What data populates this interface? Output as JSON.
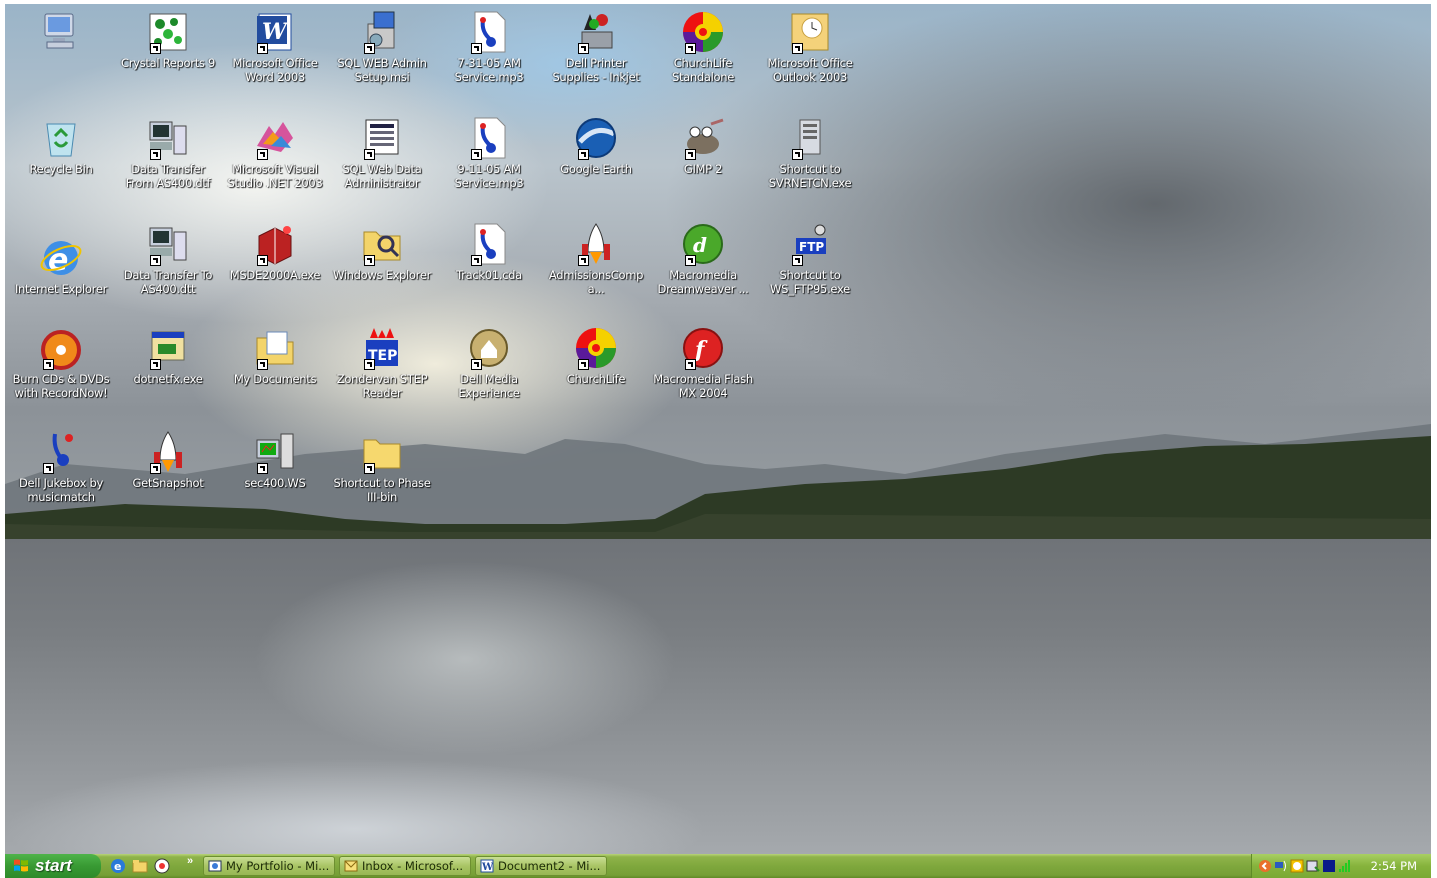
{
  "desktop": {
    "icons": [
      {
        "label": "",
        "icon": "my-computer-icon"
      },
      {
        "label": "Crystal Reports 9",
        "icon": "crystal-reports-icon"
      },
      {
        "label": "Microsoft Office Word 2003",
        "icon": "word-icon"
      },
      {
        "label": "SQL WEB Admin Setup.msi",
        "icon": "installer-icon"
      },
      {
        "label": "7-31-05 AM Service.mp3",
        "icon": "mp3-icon"
      },
      {
        "label": "Dell Printer Supplies - Inkjet",
        "icon": "printer-supplies-icon"
      },
      {
        "label": "ChurchLife Standalone",
        "icon": "churchlife-icon"
      },
      {
        "label": "Microsoft Office Outlook 2003",
        "icon": "outlook-icon"
      },
      {
        "label": "Recycle Bin",
        "icon": "recycle-bin-icon"
      },
      {
        "label": "Data Transfer From AS400.dtf",
        "icon": "data-transfer-icon"
      },
      {
        "label": "Microsoft Visual Studio .NET 2003",
        "icon": "visual-studio-icon"
      },
      {
        "label": "SQL Web Data Administrator",
        "icon": "sql-admin-icon"
      },
      {
        "label": "9-11-05 AM Service.mp3",
        "icon": "mp3-icon"
      },
      {
        "label": "Google Earth",
        "icon": "google-earth-icon"
      },
      {
        "label": "GIMP 2",
        "icon": "gimp-icon"
      },
      {
        "label": "Shortcut to SVRNETCN.exe",
        "icon": "server-icon"
      },
      {
        "label": "Internet Explorer",
        "icon": "internet-explorer-icon"
      },
      {
        "label": "Data Transfer To AS400.dtt",
        "icon": "data-transfer-icon"
      },
      {
        "label": "MSDE2000A.exe",
        "icon": "msde-icon"
      },
      {
        "label": "Windows Explorer",
        "icon": "windows-explorer-icon"
      },
      {
        "label": "Track01.cda",
        "icon": "cd-audio-icon"
      },
      {
        "label": "AdmissionsCompa...",
        "icon": "rocket-icon"
      },
      {
        "label": "Macromedia Dreamweaver ...",
        "icon": "dreamweaver-icon"
      },
      {
        "label": "Shortcut to WS_FTP95.exe",
        "icon": "ftp-icon"
      },
      {
        "label": "Burn CDs & DVDs with RecordNow!",
        "icon": "recordnow-icon"
      },
      {
        "label": "dotnetfx.exe",
        "icon": "setup-exe-icon"
      },
      {
        "label": "My Documents",
        "icon": "my-documents-icon"
      },
      {
        "label": "Zondervan STEP Reader",
        "icon": "step-reader-icon"
      },
      {
        "label": "Dell Media Experience",
        "icon": "dell-media-icon"
      },
      {
        "label": "ChurchLife",
        "icon": "churchlife-icon"
      },
      {
        "label": "Macromedia Flash MX 2004",
        "icon": "flash-icon"
      },
      {
        "label": "Dell Jukebox by musicmatch",
        "icon": "jukebox-icon"
      },
      {
        "label": "GetSnapshot",
        "icon": "rocket-icon"
      },
      {
        "label": "sec400.WS",
        "icon": "terminal-icon"
      },
      {
        "label": "Shortcut to Phase III-bin",
        "icon": "folder-icon"
      }
    ]
  },
  "taskbar": {
    "start_label": "start",
    "quick_launch_more": "»",
    "tasks": [
      {
        "label": "My Portfolio - Mi...",
        "icon": "explorer-window-icon"
      },
      {
        "label": "Inbox - Microsof...",
        "icon": "outlook-window-icon"
      },
      {
        "label": "Document2 - Mi...",
        "icon": "word-window-icon"
      }
    ],
    "clock": "2:54 PM"
  },
  "colors": {
    "taskbar": "#7fa83d",
    "start_button": "#389a33",
    "label_text": "#ffffff"
  }
}
